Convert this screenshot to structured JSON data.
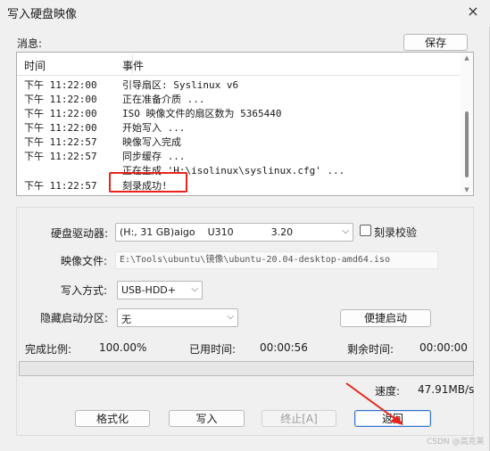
{
  "window": {
    "title": "写入硬盘映像",
    "close_icon": "×"
  },
  "messages": {
    "label": "消息:",
    "save_button": "保存",
    "columns": {
      "time": "时间",
      "event": "事件"
    },
    "rows": [
      {
        "time": "下午 11:22:00",
        "event": "引导扇区: Syslinux v6"
      },
      {
        "time": "下午 11:22:00",
        "event": "正在准备介质 ..."
      },
      {
        "time": "下午 11:22:00",
        "event": "ISO 映像文件的扇区数为 5365440"
      },
      {
        "time": "下午 11:22:00",
        "event": "开始写入 ..."
      },
      {
        "time": "下午 11:22:57",
        "event": "映像写入完成"
      },
      {
        "time": "下午 11:22:57",
        "event": "同步缓存 ..."
      },
      {
        "time": "",
        "event": "正在生成 'H:\\isolinux\\syslinux.cfg' ..."
      },
      {
        "time": "下午 11:22:57",
        "event": "刻录成功!"
      }
    ]
  },
  "form": {
    "drive_label": "硬盘驱动器:",
    "drive_value": "(H:, 31 GB)aigo    U310            3.20",
    "verify_label": "刻录校验",
    "verify_checked": false,
    "image_label": "映像文件:",
    "image_path": "E:\\Tools\\ubuntu\\镜像\\ubuntu-20.04-desktop-amd64.iso",
    "write_mode_label": "写入方式:",
    "write_mode_value": "USB-HDD+",
    "hidden_partition_label": "隐藏启动分区:",
    "hidden_partition_value": "无",
    "quick_boot_button": "便捷启动"
  },
  "stats": {
    "completion_label": "完成比例:",
    "completion_value": "100.00%",
    "elapsed_label": "已用时间:",
    "elapsed_value": "00:00:56",
    "remaining_label": "剩余时间:",
    "remaining_value": "00:00:00",
    "speed_label": "速度:",
    "speed_value": "47.91MB/s",
    "progress_fraction": 0
  },
  "buttons": {
    "format": "格式化",
    "write": "写入",
    "abort": "终止[A]",
    "back": "返回"
  },
  "colors": {
    "highlight": "#e8231c",
    "progress": "#06b025"
  },
  "watermark": "CSDN @高克莱"
}
